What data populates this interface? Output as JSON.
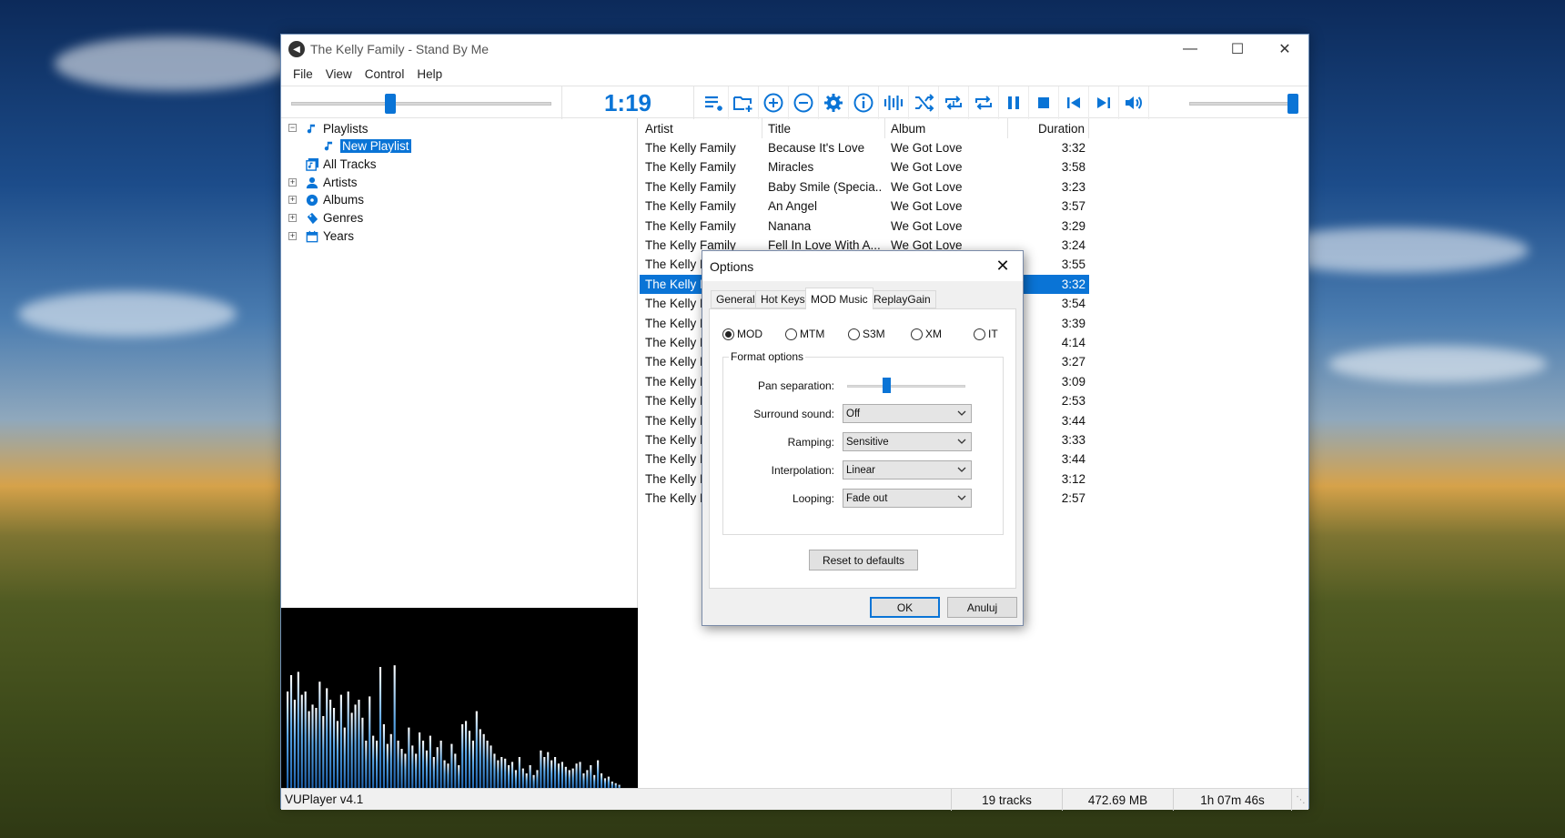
{
  "window": {
    "title": "The Kelly Family - Stand By Me",
    "menu": [
      "File",
      "View",
      "Control",
      "Help"
    ]
  },
  "toolbar": {
    "time": "1:19",
    "seek_progress": 0.38,
    "volume_level": 0.95,
    "buttons": [
      "playlist-menu-icon",
      "add-folder-icon",
      "add-icon",
      "remove-icon",
      "gear-icon",
      "info-icon",
      "equalizer-icon",
      "shuffle-icon",
      "repeat-track-icon",
      "repeat-all-icon",
      "pause-icon",
      "stop-icon",
      "previous-icon",
      "next-icon",
      "volume-icon"
    ]
  },
  "tree": {
    "playlists": "Playlists",
    "new_playlist": "New Playlist",
    "all_tracks": "All Tracks",
    "artists": "Artists",
    "albums": "Albums",
    "genres": "Genres",
    "years": "Years"
  },
  "columns": {
    "artist": "Artist",
    "title": "Title",
    "album": "Album",
    "duration": "Duration"
  },
  "tracks": [
    {
      "artist": "The Kelly Family",
      "title": "Because It's Love",
      "album": "We Got Love",
      "duration": "3:32"
    },
    {
      "artist": "The Kelly Family",
      "title": "Miracles",
      "album": "We Got Love",
      "duration": "3:58"
    },
    {
      "artist": "The Kelly Family",
      "title": "Baby Smile (Specia...",
      "album": "We Got Love",
      "duration": "3:23"
    },
    {
      "artist": "The Kelly Family",
      "title": "An Angel",
      "album": "We Got Love",
      "duration": "3:57"
    },
    {
      "artist": "The Kelly Family",
      "title": "Nanana",
      "album": "We Got Love",
      "duration": "3:29"
    },
    {
      "artist": "The Kelly Family",
      "title": "Fell In Love With A...",
      "album": "We Got Love",
      "duration": "3:24"
    },
    {
      "artist": "The Kelly F",
      "title": "",
      "album": "",
      "duration": "3:55"
    },
    {
      "artist": "The Kelly F",
      "title": "",
      "album": "",
      "duration": "3:32"
    },
    {
      "artist": "The Kelly F",
      "title": "",
      "album": "",
      "duration": "3:54"
    },
    {
      "artist": "The Kelly F",
      "title": "",
      "album": "",
      "duration": "3:39"
    },
    {
      "artist": "The Kelly F",
      "title": "",
      "album": "",
      "duration": "4:14"
    },
    {
      "artist": "The Kelly F",
      "title": "",
      "album": "",
      "duration": "3:27"
    },
    {
      "artist": "The Kelly F",
      "title": "",
      "album": "",
      "duration": "3:09"
    },
    {
      "artist": "The Kelly F",
      "title": "",
      "album": "",
      "duration": "2:53"
    },
    {
      "artist": "The Kelly F",
      "title": "",
      "album": "",
      "duration": "3:44"
    },
    {
      "artist": "The Kelly F",
      "title": "",
      "album": "",
      "duration": "3:33"
    },
    {
      "artist": "The Kelly F",
      "title": "",
      "album": "",
      "duration": "3:44"
    },
    {
      "artist": "The Kelly F",
      "title": "",
      "album": "",
      "duration": "3:12"
    },
    {
      "artist": "The Kelly F",
      "title": "",
      "album": "",
      "duration": "2:57"
    }
  ],
  "selected_track_index": 7,
  "visualizer": {
    "levels": [
      0.6,
      0.7,
      0.55,
      0.72,
      0.58,
      0.6,
      0.48,
      0.52,
      0.5,
      0.66,
      0.45,
      0.62,
      0.55,
      0.5,
      0.42,
      0.58,
      0.38,
      0.6,
      0.47,
      0.52,
      0.55,
      0.44,
      0.3,
      0.57,
      0.33,
      0.3,
      0.75,
      0.4,
      0.28,
      0.34,
      0.76,
      0.3,
      0.25,
      0.22,
      0.38,
      0.27,
      0.22,
      0.35,
      0.3,
      0.24,
      0.33,
      0.2,
      0.26,
      0.3,
      0.18,
      0.16,
      0.28,
      0.22,
      0.15,
      0.4,
      0.42,
      0.36,
      0.3,
      0.48,
      0.37,
      0.34,
      0.3,
      0.27,
      0.22,
      0.18,
      0.2,
      0.19,
      0.15,
      0.17,
      0.12,
      0.2,
      0.13,
      0.1,
      0.15,
      0.09,
      0.12,
      0.24,
      0.2,
      0.23,
      0.18,
      0.2,
      0.16,
      0.17,
      0.14,
      0.12,
      0.13,
      0.16,
      0.17,
      0.1,
      0.12,
      0.15,
      0.09,
      0.18,
      0.1,
      0.07,
      0.08,
      0.05,
      0.04,
      0.03
    ]
  },
  "status": {
    "version": "VUPlayer v4.1",
    "tracks": "19 tracks",
    "size": "472.69 MB",
    "duration": "1h 07m 46s"
  },
  "dialog": {
    "title": "Options",
    "tabs": [
      "General",
      "Hot Keys",
      "MOD Music",
      "ReplayGain"
    ],
    "active_tab": 2,
    "formats": [
      "MOD",
      "MTM",
      "S3M",
      "XM",
      "IT"
    ],
    "selected_format": 0,
    "group_label": "Format options",
    "pan_label": "Pan separation:",
    "pan_level": 0.33,
    "surround_label": "Surround sound:",
    "surround_value": "Off",
    "ramping_label": "Ramping:",
    "ramping_value": "Sensitive",
    "interp_label": "Interpolation:",
    "interp_value": "Linear",
    "looping_label": "Looping:",
    "looping_value": "Fade out",
    "reset_label": "Reset to defaults",
    "ok_label": "OK",
    "cancel_label": "Anuluj"
  },
  "colors": {
    "accent": "#0a74d6",
    "visualizer_bar": "#5aa6e6"
  }
}
